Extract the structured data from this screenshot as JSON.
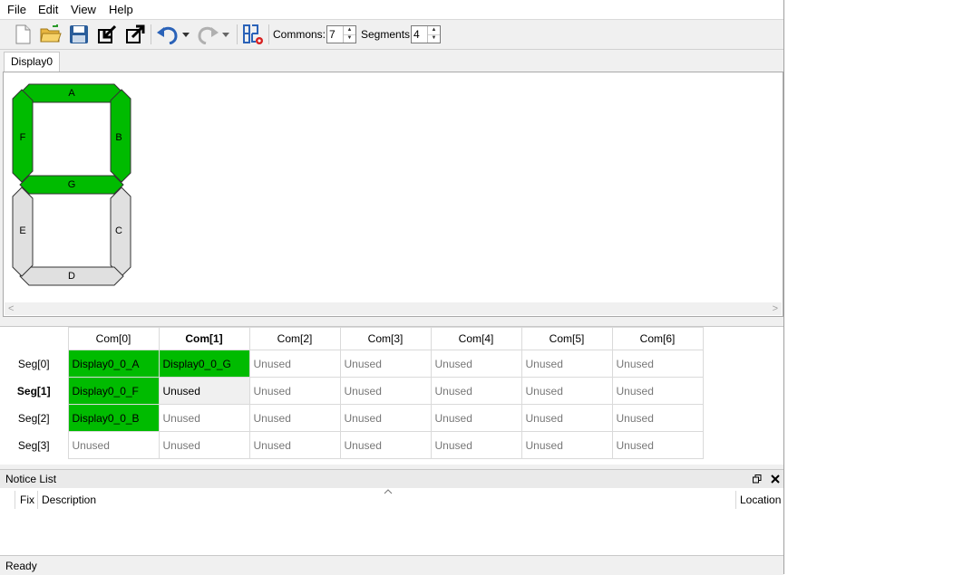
{
  "menu": {
    "file": "File",
    "edit": "Edit",
    "view": "View",
    "help": "Help"
  },
  "toolbar": {
    "commons_label": "Commons:",
    "commons_value": "7",
    "segments_label": "Segments:",
    "segments_value": "4"
  },
  "tab": {
    "label": "Display0"
  },
  "display": {
    "segments": [
      {
        "id": "A",
        "on": true
      },
      {
        "id": "B",
        "on": true
      },
      {
        "id": "C",
        "on": false
      },
      {
        "id": "D",
        "on": false
      },
      {
        "id": "E",
        "on": false
      },
      {
        "id": "F",
        "on": true
      },
      {
        "id": "G",
        "on": true
      }
    ],
    "on_color": "#00bb00",
    "off_color": "#e0e0e0"
  },
  "grid": {
    "columns": [
      "Com[0]",
      "Com[1]",
      "Com[2]",
      "Com[3]",
      "Com[4]",
      "Com[5]",
      "Com[6]"
    ],
    "rows": [
      {
        "label": "Seg[0]",
        "cells": [
          "Display0_0_A",
          "Display0_0_G",
          "Unused",
          "Unused",
          "Unused",
          "Unused",
          "Unused"
        ]
      },
      {
        "label": "Seg[1]",
        "cells": [
          "Display0_0_F",
          "Unused",
          "Unused",
          "Unused",
          "Unused",
          "Unused",
          "Unused"
        ]
      },
      {
        "label": "Seg[2]",
        "cells": [
          "Display0_0_B",
          "Unused",
          "Unused",
          "Unused",
          "Unused",
          "Unused",
          "Unused"
        ]
      },
      {
        "label": "Seg[3]",
        "cells": [
          "Unused",
          "Unused",
          "Unused",
          "Unused",
          "Unused",
          "Unused",
          "Unused"
        ]
      }
    ]
  },
  "notice": {
    "title": "Notice List",
    "col_fix": "Fix",
    "col_description": "Description",
    "col_location": "Location"
  },
  "status": {
    "text": "Ready"
  }
}
